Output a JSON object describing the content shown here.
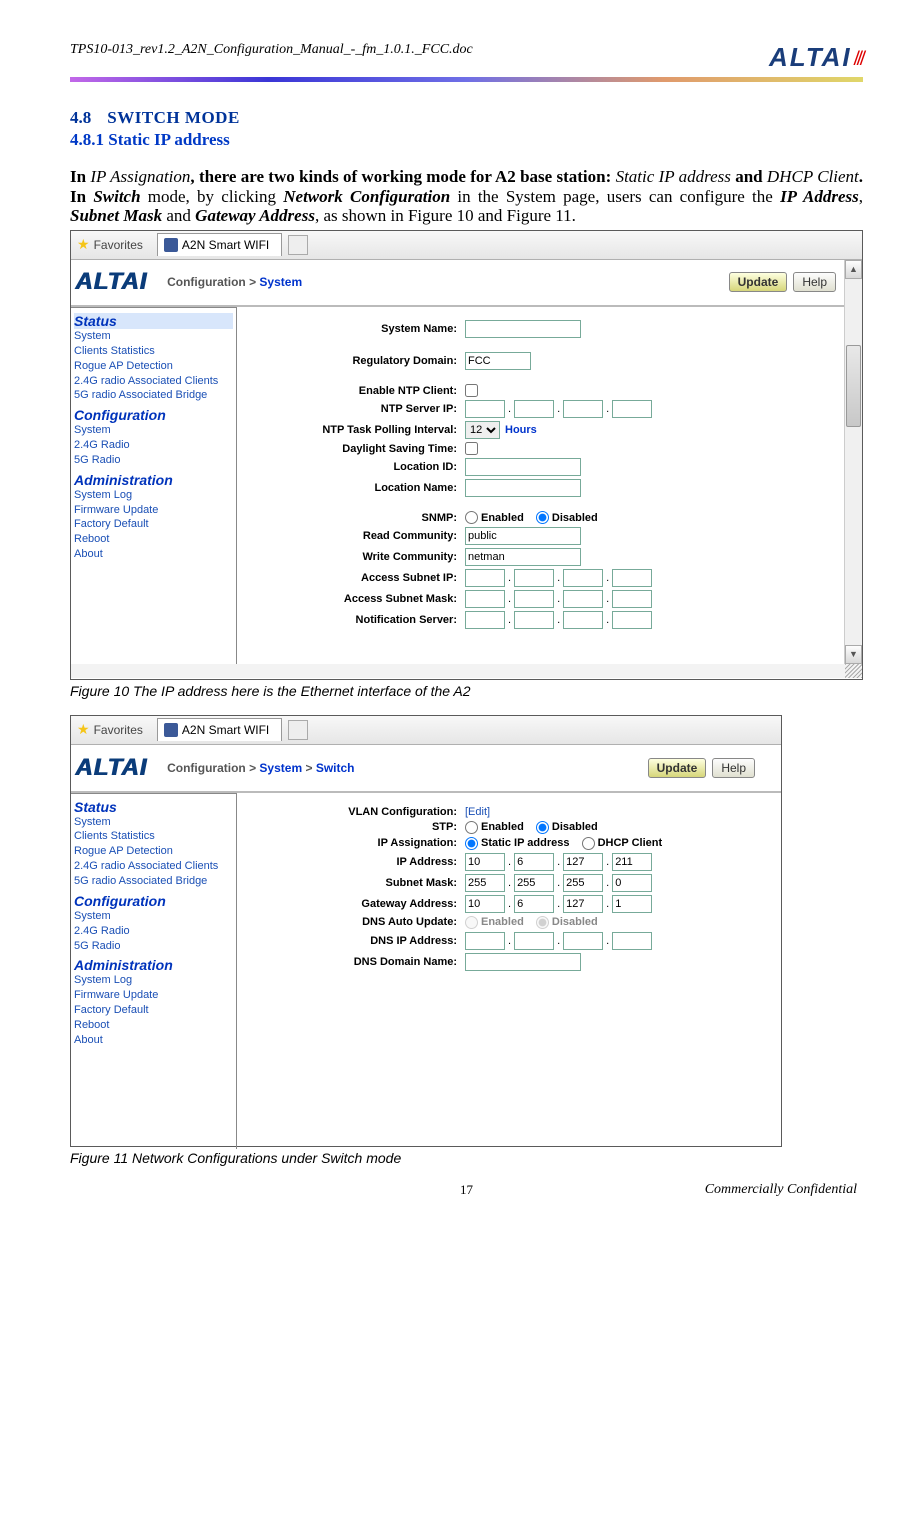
{
  "doc_header": "TPS10-013_rev1.2_A2N_Configuration_Manual_-_fm_1.0.1._FCC.doc",
  "logo": "ALTAI",
  "section": {
    "num": "4.8",
    "title": "SWITCH MODE"
  },
  "subsection": "4.8.1    Static IP address",
  "para": {
    "p1a": "In ",
    "p1b": "IP Assignation",
    "p1c": ", there are two kinds of working mode for A2 base station: ",
    "p1d": "Static IP address",
    "p1e": " and ",
    "p1f": "DHCP Client",
    "p1g": ". In ",
    "p1h": "Switch",
    "p1i": " mode, by clicking ",
    "p1j": "Network Configuration",
    "p1k": " in the System page, users can configure the ",
    "p1l": "IP Address",
    "p1m": ", ",
    "p1n": "Subnet Mask",
    "p1o": " and ",
    "p1p": "Gateway Address",
    "p1q": ", as shown in Figure 10 and Figure 11."
  },
  "favorites": "Favorites",
  "tab_title": "A2N Smart WIFI",
  "altai_brand": "ALTAI",
  "bc1": {
    "prefix": "Configuration > ",
    "tail": "System"
  },
  "bc2": {
    "prefix": "Configuration > ",
    "mid": "System",
    "sep": " > ",
    "tail": "Switch"
  },
  "buttons": {
    "update": "Update",
    "help": "Help"
  },
  "sidebar": {
    "status": "Status",
    "status_items": [
      "System",
      "Clients Statistics",
      "Rogue AP Detection",
      "2.4G radio Associated Clients",
      "5G radio Associated Bridge"
    ],
    "config": "Configuration",
    "config_items": [
      "System",
      "2.4G Radio",
      "5G Radio"
    ],
    "admin": "Administration",
    "admin_items": [
      "System Log",
      "Firmware Update",
      "Factory Default",
      "Reboot",
      "About"
    ]
  },
  "form1": {
    "system_name": "System Name:",
    "reg_domain": "Regulatory Domain:",
    "reg_domain_val": "FCC",
    "ntp_enable": "Enable NTP Client:",
    "ntp_ip": "NTP Server IP:",
    "ntp_poll": "NTP Task Polling Interval:",
    "ntp_poll_val": "12",
    "hours": "Hours",
    "dst": "Daylight Saving Time:",
    "loc_id": "Location ID:",
    "loc_name": "Location Name:",
    "snmp": "SNMP:",
    "enabled": "Enabled",
    "disabled": "Disabled",
    "read_comm": "Read Community:",
    "read_comm_val": "public",
    "write_comm": "Write Community:",
    "write_comm_val": "netman",
    "access_ip": "Access Subnet IP:",
    "access_mask": "Access Subnet Mask:",
    "notif": "Notification Server:"
  },
  "form2": {
    "vlan": "VLAN Configuration:",
    "edit": "[Edit]",
    "stp": "STP:",
    "ip_assign": "IP Assignation:",
    "static_ip": "Static IP address",
    "dhcp": "DHCP Client",
    "ip_addr": "IP Address:",
    "ip_v": [
      "10",
      "6",
      "127",
      "211"
    ],
    "subnet": "Subnet Mask:",
    "subnet_v": [
      "255",
      "255",
      "255",
      "0"
    ],
    "gateway": "Gateway Address:",
    "gateway_v": [
      "10",
      "6",
      "127",
      "1"
    ],
    "dns_auto": "DNS Auto Update:",
    "dns_ip": "DNS IP Address:",
    "dns_name": "DNS Domain Name:",
    "enabled": "Enabled",
    "disabled": "Disabled"
  },
  "caption1": "Figure 10      The IP address here is the Ethernet interface of the A2",
  "caption2": "Figure 11      Network Configurations under Switch mode",
  "footer": {
    "page": "17",
    "conf": "Commercially Confidential"
  }
}
